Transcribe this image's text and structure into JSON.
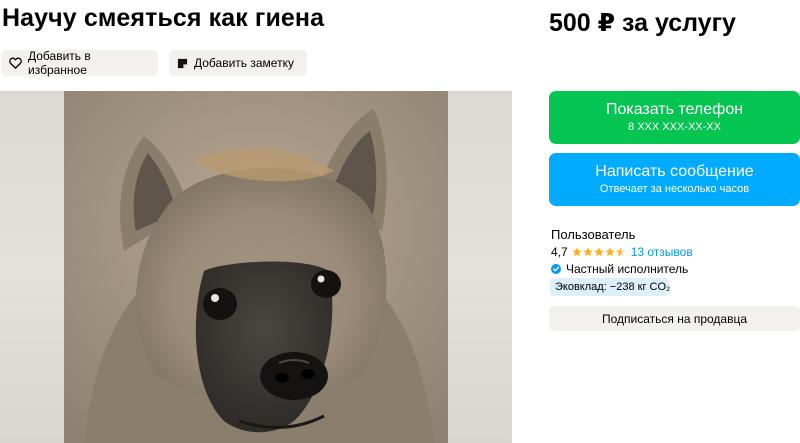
{
  "listing": {
    "title": "Научу смеяться как гиена",
    "price": "500 ₽ за услугу"
  },
  "actions": {
    "favorite_label": "Добавить в избранное",
    "note_label": "Добавить заметку"
  },
  "contact": {
    "phone_label": "Показать телефон",
    "phone_masked": "8 XXX XXX-XX-XX",
    "message_label": "Написать сообщение",
    "message_sub": "Отвечает за несколько часов",
    "phone_color": "#04c452",
    "message_color": "#00aaff"
  },
  "seller": {
    "label": "Пользователь",
    "rating": "4,7",
    "stars_value": 4.7,
    "stars_max": 5,
    "reviews": "13 отзывов",
    "verified_text": "Частный исполнитель",
    "eco_text": "Эковклад: −238 кг CO₂",
    "subscribe_label": "Подписаться на продавца",
    "star_color": "#ffb021",
    "link_color": "#0099f7"
  },
  "icons": {
    "favorite": "heart-icon",
    "note": "note-icon",
    "verified": "verified-check-icon",
    "star": "star-icon"
  }
}
